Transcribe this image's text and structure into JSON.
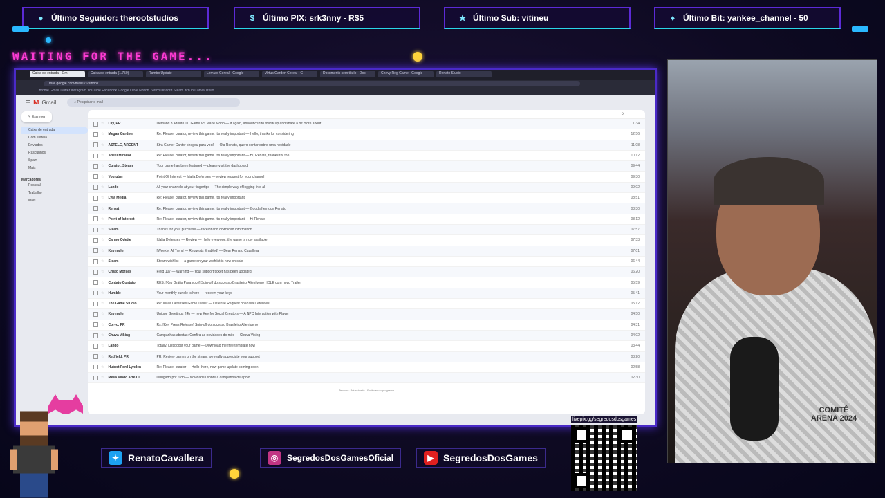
{
  "stats": {
    "follower": "Último Seguidor: therootstudios",
    "pix": "Último PIX: srk3nny - R$5",
    "sub": "Último Sub: vitineu",
    "bit": "Último Bit: yankee_channel - 50"
  },
  "waiting_text": "WAITING FOR THE GAME...",
  "browser": {
    "tabs": [
      "Caixa de entrada - Gm",
      "Caixa de entrada (1.750)",
      "Rambo Update",
      "Lemurs Cereal - Google",
      "Virtus Garden Cereal - C",
      "Documents sem título - Doc",
      "Chevy Reg Game - Google",
      "Renato Studio"
    ],
    "url": "mail.google.com/mail/u/1/#inbox",
    "bookmarks": "Chrome  Gmail  Twitter  Instagram  YouTube  Facebook  Google Drive  Notion  Twitch  Discord  Steam  Itch.io  Canva  Trello"
  },
  "gmail": {
    "logo_text": "Gmail",
    "search_placeholder": "Pesquisar e-mail",
    "compose": "Escrever",
    "sidebar": [
      "Caixa de entrada",
      "Com estrela",
      "Enviados",
      "Rascunhos",
      "Spam",
      "Mais"
    ],
    "labels_header": "Marcadores",
    "labels": [
      "Pessoal",
      "Trabalho",
      "Mais"
    ],
    "rows": [
      {
        "from": "Lily, PR",
        "subj": "Demand 3 Azerite TC Game VS Make Mono — It again, announced to follow up and share a bit more about",
        "date": "1:34"
      },
      {
        "from": "Megan Gardner",
        "subj": "Re: Please, curator, review this game. It's really important — Hello, thanks for considering",
        "date": "12:56"
      },
      {
        "from": "ASTELE, ARGENT",
        "subj": "Stra Gamer Cantor chegou para você — Ola Renato, quero contar sobre uma novidade",
        "date": "11:08"
      },
      {
        "from": "Aneel Mirador",
        "subj": "Re: Please, curator, review this game. It's really important — Hi, Renato, thanks for the",
        "date": "10:12"
      },
      {
        "from": "Curator, Steam",
        "subj": "Your game has been featured — please visit the dashboard",
        "date": "09:44"
      },
      {
        "from": "Youtuber",
        "subj": "Point Of Interest — Idalia Defenses — review request for your channel",
        "date": "09:30"
      },
      {
        "from": "Lando",
        "subj": "All your channels at your fingertips — The simple way of logging into all",
        "date": "09:02"
      },
      {
        "from": "Lyra Media",
        "subj": "Re: Please, curator, review this game. It's really important",
        "date": "08:51"
      },
      {
        "from": "Renart",
        "subj": "Re: Please, curator, review this game. It's really important — Good afternoon Renato",
        "date": "08:30"
      },
      {
        "from": "Point of Interest",
        "subj": "Re: Please, curator, review this game. It's really important — Hi Renato",
        "date": "08:12"
      },
      {
        "from": "Steam",
        "subj": "Thanks for your purchase — receipt and download information",
        "date": "07:57"
      },
      {
        "from": "Carmo Odette",
        "subj": "Idalia Defenses — Review — Hello everyone, the game is now available",
        "date": "07:33"
      },
      {
        "from": "Keymailer",
        "subj": "[Weekly: AI Trend — Requests Enabled] — Dear Renato Cavallera",
        "date": "07:01"
      },
      {
        "from": "Steam",
        "subj": "Steam wishlist — a game on your wishlist is now on sale",
        "date": "06:44"
      },
      {
        "from": "Cristo Moraes",
        "subj": "Field 107 — Warning — Your support ticket has been updated",
        "date": "06:20"
      },
      {
        "from": "Contato Contato",
        "subj": "RES: [Key Grátis Para você] Spin-off do sucesso Brasileiro Alienígeno HOLE com novo Trailer",
        "date": "05:59"
      },
      {
        "from": "Humble",
        "subj": "Your monthly bundle is here — redeem your keys",
        "date": "05:41"
      },
      {
        "from": "The Game Studio",
        "subj": "Re: Idalia Defenses Game Trailer — Defense Request on Idalia Defenses",
        "date": "05:12"
      },
      {
        "from": "Keymailer",
        "subj": "Unique Greetings 24h — new Key for Social Creators — A NPC Interaction with Player",
        "date": "04:50"
      },
      {
        "from": "Corvo, PR",
        "subj": "Rs: [Key Press Release] Spin-off do sucesso Brasileiro Alienígeno",
        "date": "04:31"
      },
      {
        "from": "Chuva Viking",
        "subj": "Campanhas abertas: Confira as novidades do mês — Chuva Viking",
        "date": "04:02"
      },
      {
        "from": "Lando",
        "subj": "Totally, just boost your game — Download the free template now",
        "date": "03:44"
      },
      {
        "from": "Redfield, PR",
        "subj": "PR: Review games on the steam, we really appreciate your support",
        "date": "03:20"
      },
      {
        "from": "Hubert Ford Lynden",
        "subj": "Re: Please, curator — Hello there, new game update coming soon",
        "date": "02:58"
      },
      {
        "from": "Mesa Vindo Arte Ci",
        "subj": "Obrigado por tudo — Novidades sobre a campanha de apoio",
        "date": "02:30"
      }
    ],
    "footer": "Termos · Privacidade · Políticas do programa"
  },
  "cam": {
    "badge": "COMITÊ ARENA 2024"
  },
  "socials": {
    "twitter": "RenatoCavallera",
    "instagram": "SegredosDosGamesOficial",
    "youtube": "SegredosDosGames"
  },
  "qr_label": "livepix.gg/segredosdosgames",
  "colors": {
    "frame": "#4a2ac8",
    "accent": "#2ab8ff",
    "waiting": "#ff3bd4"
  }
}
